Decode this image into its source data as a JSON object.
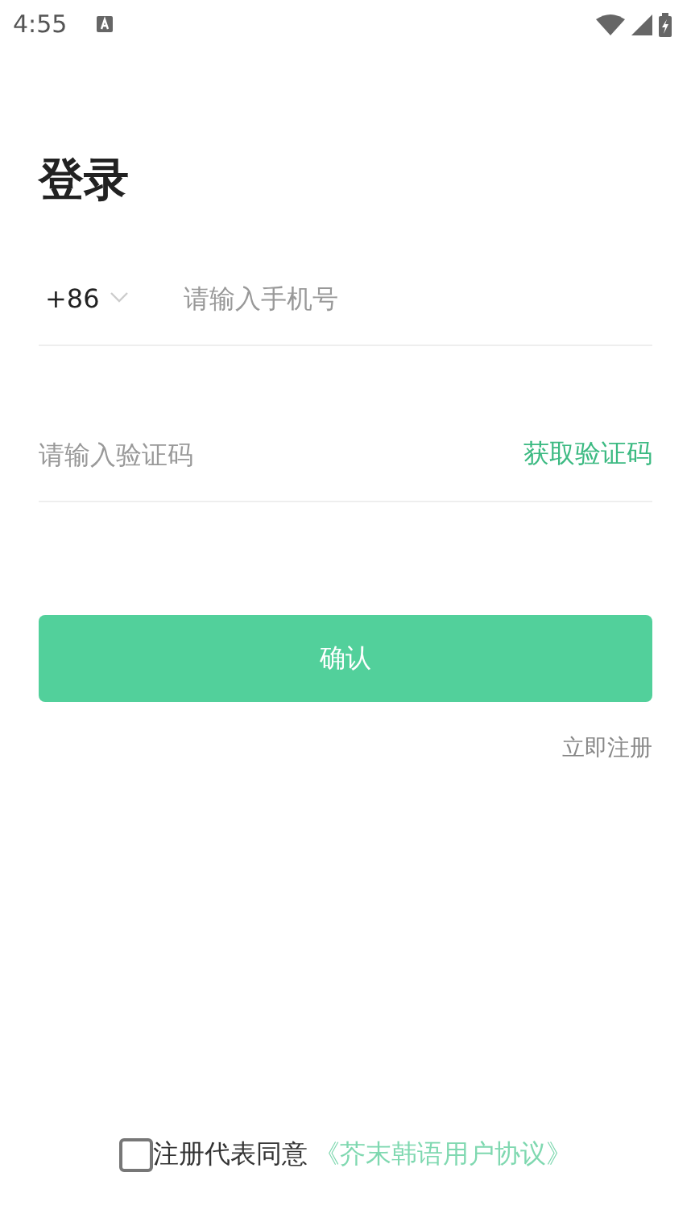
{
  "status_bar": {
    "time": "4:55"
  },
  "title": "登录",
  "phone": {
    "country_code": "+86",
    "placeholder": "请输入手机号"
  },
  "code": {
    "placeholder": "请输入验证码",
    "get_code": "获取验证码"
  },
  "confirm_button": "确认",
  "register_link": "立即注册",
  "agreement": {
    "checked": false,
    "text": "注册代表同意",
    "link": "《芥末韩语用户协议》"
  }
}
